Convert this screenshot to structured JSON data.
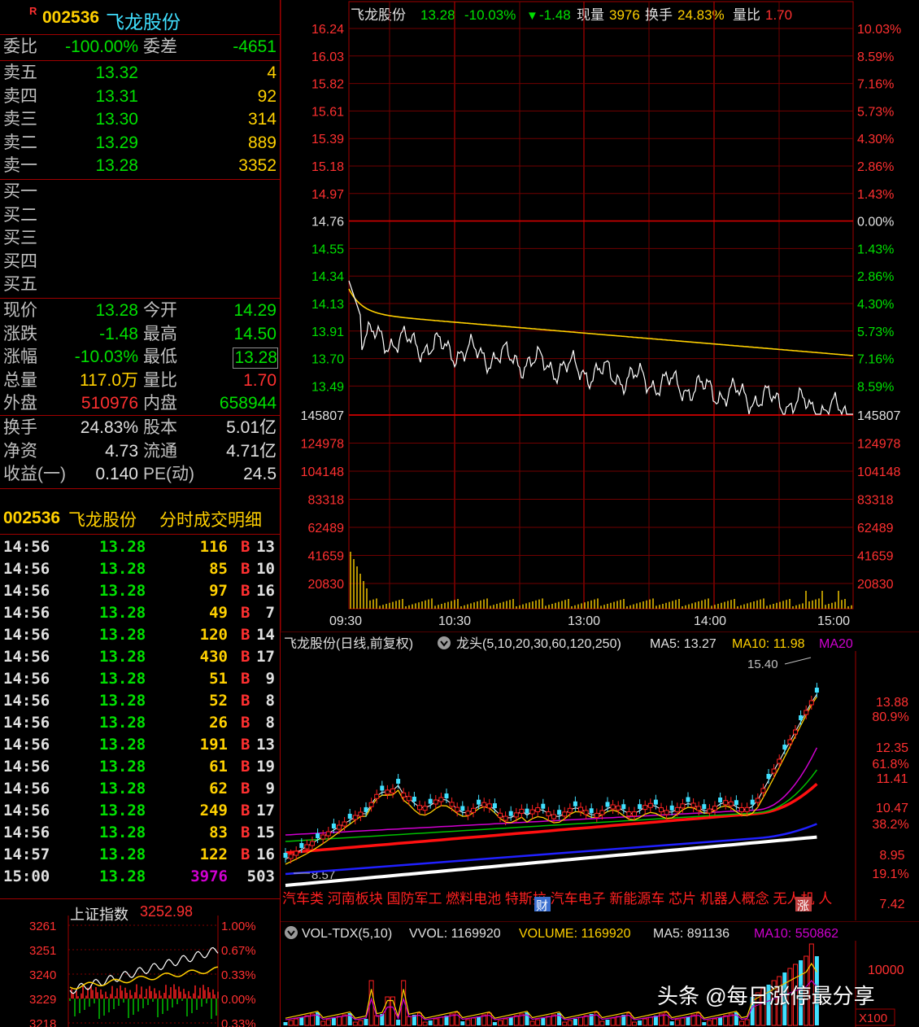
{
  "header": {
    "badge": "R",
    "code": "002536",
    "name": "飞龙股份"
  },
  "weibi": {
    "label": "委比",
    "value": "-100.00%",
    "diff_label": "委差",
    "diff_value": "-4651"
  },
  "sell": [
    {
      "label": "卖五",
      "price": "13.32",
      "vol": "4"
    },
    {
      "label": "卖四",
      "price": "13.31",
      "vol": "92"
    },
    {
      "label": "卖三",
      "price": "13.30",
      "vol": "314"
    },
    {
      "label": "卖二",
      "price": "13.29",
      "vol": "889"
    },
    {
      "label": "卖一",
      "price": "13.28",
      "vol": "3352"
    }
  ],
  "buy": [
    {
      "label": "买一"
    },
    {
      "label": "买二"
    },
    {
      "label": "买三"
    },
    {
      "label": "买四"
    },
    {
      "label": "买五"
    }
  ],
  "quote": [
    {
      "l1": "现价",
      "v1": "13.28",
      "l2": "今开",
      "v2": "14.29",
      "c1": "g",
      "c2": "g"
    },
    {
      "l1": "涨跌",
      "v1": "-1.48",
      "l2": "最高",
      "v2": "14.50",
      "c1": "g",
      "c2": "g"
    },
    {
      "l1": "涨幅",
      "v1": "-10.03%",
      "l2": "最低",
      "v2": "13.28",
      "c1": "g",
      "c2": "g"
    },
    {
      "l1": "总量",
      "v1": "117.0万",
      "l2": "量比",
      "v2": "1.70",
      "c1": "y",
      "c2": "r"
    },
    {
      "l1": "外盘",
      "v1": "510976",
      "l2": "内盘",
      "v2": "658944",
      "c1": "r",
      "c2": "g"
    }
  ],
  "fund": [
    {
      "l1": "换手",
      "v1": "24.83%",
      "l2": "股本",
      "v2": "5.01亿"
    },
    {
      "l1": "净资",
      "v1": "4.73",
      "l2": "流通",
      "v2": "4.71亿"
    },
    {
      "l1": "收益(一)",
      "v1": "0.140",
      "l2": "PE(动)",
      "v2": "24.5"
    }
  ],
  "detail_header": {
    "code": "002536",
    "name": "飞龙股份",
    "title": "分时成交明细"
  },
  "details": [
    {
      "t": "14:56",
      "p": "13.28",
      "v": "116",
      "s": "B",
      "n": "13"
    },
    {
      "t": "14:56",
      "p": "13.28",
      "v": "85",
      "s": "B",
      "n": "10"
    },
    {
      "t": "14:56",
      "p": "13.28",
      "v": "97",
      "s": "B",
      "n": "16"
    },
    {
      "t": "14:56",
      "p": "13.28",
      "v": "49",
      "s": "B",
      "n": "7"
    },
    {
      "t": "14:56",
      "p": "13.28",
      "v": "120",
      "s": "B",
      "n": "14"
    },
    {
      "t": "14:56",
      "p": "13.28",
      "v": "430",
      "s": "B",
      "n": "17"
    },
    {
      "t": "14:56",
      "p": "13.28",
      "v": "51",
      "s": "B",
      "n": "9"
    },
    {
      "t": "14:56",
      "p": "13.28",
      "v": "52",
      "s": "B",
      "n": "8"
    },
    {
      "t": "14:56",
      "p": "13.28",
      "v": "26",
      "s": "B",
      "n": "8"
    },
    {
      "t": "14:56",
      "p": "13.28",
      "v": "191",
      "s": "B",
      "n": "13"
    },
    {
      "t": "14:56",
      "p": "13.28",
      "v": "61",
      "s": "B",
      "n": "19"
    },
    {
      "t": "14:56",
      "p": "13.28",
      "v": "62",
      "s": "B",
      "n": "9"
    },
    {
      "t": "14:56",
      "p": "13.28",
      "v": "249",
      "s": "B",
      "n": "17"
    },
    {
      "t": "14:56",
      "p": "13.28",
      "v": "83",
      "s": "B",
      "n": "15"
    },
    {
      "t": "14:57",
      "p": "13.28",
      "v": "122",
      "s": "B",
      "n": "16"
    },
    {
      "t": "15:00",
      "p": "13.28",
      "v": "3976",
      "s": "",
      "n": "503"
    }
  ],
  "index": {
    "name": "上证指数",
    "value": "3252.98",
    "ylabels": [
      "3261",
      "3251",
      "3240",
      "3229",
      "3218"
    ],
    "pct": [
      "1.00%",
      "0.67%",
      "0.33%",
      "0.00%",
      "0.33%"
    ]
  },
  "intraday": {
    "info": {
      "name": "飞龙股份",
      "price": "13.28",
      "pct": "-10.03%",
      "arrow": "▼",
      "chg": "-1.48",
      "xl_label": "现量",
      "xl": "3976",
      "hs_label": "换手",
      "hs": "24.83%",
      "lb_label": "量比",
      "lb": "1.70"
    },
    "price_labels": [
      "16.24",
      "16.03",
      "15.82",
      "15.61",
      "15.39",
      "15.18",
      "14.97",
      "14.76",
      "14.55",
      "14.34",
      "14.13",
      "13.91",
      "13.70",
      "13.49"
    ],
    "pct_labels": [
      "10.03%",
      "8.59%",
      "7.16%",
      "5.73%",
      "4.30%",
      "2.86%",
      "1.43%",
      "0.00%",
      "1.43%",
      "2.86%",
      "4.30%",
      "5.73%",
      "7.16%",
      "8.59%"
    ],
    "vol_labels": [
      "145807",
      "124978",
      "104148",
      "83318",
      "62489",
      "41659",
      "20830"
    ],
    "time_labels": [
      "09:30",
      "10:30",
      "13:00",
      "14:00",
      "15:00"
    ]
  },
  "daily": {
    "title": "飞龙股份(日线,前复权)",
    "indicator": "龙头(5,10,20,30,60,120,250)",
    "ma5": "MA5: 13.27",
    "ma10": "MA10: 11.98",
    "ma20": "MA20",
    "high_mark": "15.40",
    "low_mark": "8.57",
    "ylabels": [
      "13.88",
      "12.35",
      "11.41",
      "10.47",
      "8.95",
      "7.42"
    ],
    "pct_labels": [
      "80.9%",
      "61.8%",
      "38.2%",
      "19.1%"
    ],
    "tags": "汽车类 河南板块 国防军工 燃料电池 特斯拉 汽车电子 新能源车 芯片 机器人概念 无人机 人",
    "badge_cai": "财",
    "badge_zhang": "涨"
  },
  "volume": {
    "title": "VOL-TDX(5,10)",
    "vvol": "VVOL: 1169920",
    "volume": "VOLUME: 1169920",
    "ma5": "MA5: 891136",
    "ma10": "MA10: 550862",
    "ylabel": "10000",
    "unit": "X100"
  },
  "watermark": "头条 @每日涨停最分享"
}
